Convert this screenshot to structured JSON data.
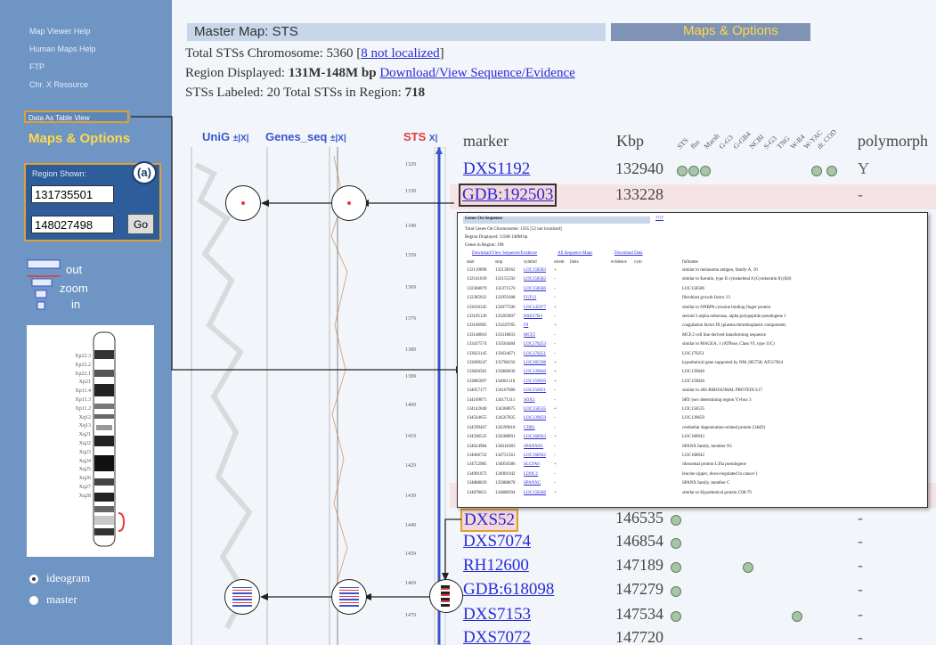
{
  "sidebar": {
    "help_links": [
      "Map Viewer Help",
      "Human Maps Help",
      "FTP",
      "Chr. X Resource"
    ],
    "data_table_view": "Data As Table View",
    "maps_options": "Maps & Options",
    "region_title": "Region Shown:",
    "annotation_a": "(a)",
    "region_start": "131735501",
    "region_end": "148027498",
    "go_label": "Go",
    "zoom_out": "out",
    "zoom": "zoom",
    "zoom_in": "in",
    "view_ideogram": "ideogram",
    "view_master": "master",
    "ideogram_bands": [
      "Xp22.3",
      "Xp22.2",
      "Xp22.1",
      "Xp21",
      "Xp11.4",
      "Xp11.3",
      "Xp11.2",
      "Xq12",
      "Xq13",
      "Xq21",
      "Xq22",
      "Xq23",
      "Xq24",
      "Xq25",
      "Xq26",
      "Xq27",
      "Xq28"
    ]
  },
  "header": {
    "title": "Master Map: STS",
    "maps_options": "Maps & Options",
    "total_sts_prefix": "Total STSs Chromosome: 5360 ",
    "total_sts_link": "8 not localized",
    "region_prefix": "Region Displayed: ",
    "region_value": "131M-148M bp",
    "region_link": "Download/View Sequence/Evidence",
    "labeled_prefix": "STSs Labeled: 20 Total STSs in Region: ",
    "labeled_total": "718"
  },
  "tracks": {
    "unig": "UniG",
    "genes_seq": "Genes_seq",
    "sts": "STS",
    "pin_icons": "±|X|",
    "sts_icon": "X|"
  },
  "table": {
    "col_marker": "marker",
    "col_kbp": "Kbp",
    "col_polymorph": "polymorph",
    "rotated_cols": [
      "STS",
      "fbn",
      "Marsh",
      "G-G3",
      "G-GB4",
      "NCBI",
      "S-G3",
      "TNG",
      "W-R4",
      "W-YAC",
      "dr. COD"
    ],
    "rows_top": [
      {
        "marker": "DXS1192",
        "kbp": "132940",
        "poly": "Y"
      },
      {
        "marker": "GDB:192503",
        "kbp": "133228",
        "poly": "-"
      }
    ],
    "rows_bottom": [
      {
        "marker": "DXS52",
        "kbp": "146535",
        "poly": "-"
      },
      {
        "marker": "DXS7074",
        "kbp": "146854",
        "poly": "-"
      },
      {
        "marker": "RH12600",
        "kbp": "147189",
        "poly": "-"
      },
      {
        "marker": "GDB:618098",
        "kbp": "147279",
        "poly": "-"
      },
      {
        "marker": "DXS7153",
        "kbp": "147534",
        "poly": "-"
      },
      {
        "marker": "DXS7072",
        "kbp": "147720",
        "poly": "-"
      }
    ]
  },
  "scale_labels": [
    "1329",
    "1339",
    "1349",
    "1359",
    "1369",
    "1379",
    "1389",
    "1399",
    "1409",
    "1419",
    "1429",
    "1439",
    "1449",
    "1459",
    "1469",
    "1479"
  ],
  "popup": {
    "title": "Genes On Sequence",
    "help": "????",
    "line1": "Total Genes On Chromosome: 1565 [52 not localized]",
    "line2": "Region Displayed: 131M-148M bp",
    "line3": "Genes in Region: 198",
    "links": [
      "Download/View Sequence/Evidence",
      "All Sequence Maps",
      "Download Data"
    ],
    "cols": [
      "start",
      "stop",
      "symbol",
      "orient",
      "links",
      "evidence",
      "cyto",
      "fullname"
    ],
    "rows": [
      [
        "132119090",
        "132138162",
        "LOC158583",
        "+",
        "similar to melanoma antigen, family A, 10"
      ],
      [
        "132141039",
        "132155592",
        "LOC158582",
        "-",
        "similar to Keratin, type II cytoskeletal 8 (Cytokeratin 8) (K8)"
      ],
      [
        "132368079",
        "132371576",
        "LOC158586",
        "-",
        "LOC158586"
      ],
      [
        "132385022",
        "132959188",
        "FGF13",
        "-",
        "fibroblast growth factor 13"
      ],
      [
        "133016345",
        "133077596",
        "LOC145977",
        "+",
        "similar to NNBP6 cytosine binding finger protein"
      ],
      [
        "133105120",
        "133203097",
        "HSD17B4",
        "-",
        "steroid 5-alpha reductase, alpha polypeptide pseudogene 1"
      ],
      [
        "133106985",
        "133229785",
        "F9",
        "+",
        "coagulation factor IX (plasma thromboplastic component)"
      ],
      [
        "133148016",
        "133318033",
        "MCF2",
        "-",
        "MCF.2 cell line derived transforming sequence"
      ],
      [
        "133437574",
        "133564484",
        "LOC170253",
        "-",
        "similar to MAGEA, 1 (ATPase, Class VI, type 11C)"
      ],
      [
        "133622145",
        "133624671",
        "LOC170251",
        "-",
        "LOC170251"
      ],
      [
        "133699247",
        "133708156",
        "LOC285398",
        "+",
        "hypothetical gene supported by NM_005758; AF517824"
      ],
      [
        "133826581",
        "133866036",
        "LOC139640",
        "+",
        "LOC139640"
      ],
      [
        "133885097",
        "134061118",
        "LOC159020",
        "+",
        "LOC159020"
      ],
      [
        "134057177",
        "134167686",
        "LOC256051",
        "-",
        "similar to 40S RIBOSOMAL PROTEIN S17"
      ],
      [
        "134169071",
        "134171311",
        "SOX3",
        "-",
        "SRY (sex determining region Y)-box 3"
      ],
      [
        "134142040",
        "134368075",
        "LOC158535",
        "+",
        "LOC158535"
      ],
      [
        "134564655",
        "134567835",
        "LOC139659",
        "-",
        "LOC139659"
      ],
      [
        "134599467",
        "134599618",
        "CDR1",
        "-",
        "cerebellar degeneration-related protein (34kD)"
      ],
      [
        "134596535",
        "134588091",
        "LOC168943",
        "+",
        "LOC168943"
      ],
      [
        "134624984",
        "134616383",
        "SPANXN1",
        "-",
        "SPANX family, member N1"
      ],
      [
        "134666732",
        "134751561",
        "LOC168942",
        "-",
        "LOC168942"
      ],
      [
        "134752985",
        "134950586",
        "SLC9A6",
        "+",
        "ribosomal protein L36a pseudogene"
      ],
      [
        "134901072",
        "134901942",
        "LDOC1",
        "-",
        "leucine zipper, down-regulated in cancer 1"
      ],
      [
        "134888029",
        "135088878",
        "SPANXC",
        "-",
        "SPANX family, member C"
      ],
      [
        "134878651",
        "134888394",
        "LOC158586",
        "+",
        "similar to Hypothetical protein C08-79"
      ]
    ]
  }
}
